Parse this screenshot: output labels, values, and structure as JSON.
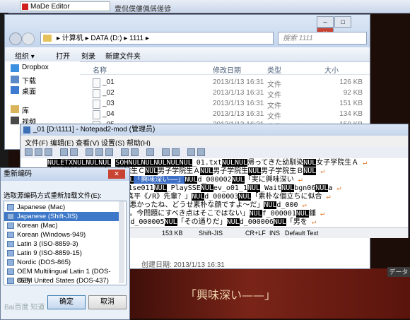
{
  "background": {
    "madeditor_tab": "MaDe Editor",
    "doc_tab": "壹侃僕僂偑偁傞偐",
    "game_text": "「興味深い——」",
    "game_badge": "データ"
  },
  "explorer": {
    "address_parts": [
      "计算机",
      "DATA (D:)",
      "1111"
    ],
    "address_text": "▸ 计算机 ▸ DATA (D:) ▸ 1111 ▸",
    "search_placeholder": "搜索 1111",
    "toolbar": [
      "组织 ▾",
      "打开",
      "刻录",
      "新建文件夹"
    ],
    "sidebar": [
      "Dropbox",
      "下载",
      "桌面",
      "库",
      "视频"
    ],
    "headers": [
      "名称",
      "修改日期",
      "类型",
      "大小"
    ],
    "files": [
      {
        "name": "_01",
        "date": "2013/1/13 16:31",
        "type": "文件",
        "size": "126 KB"
      },
      {
        "name": "_02",
        "date": "2013/1/13 16:31",
        "type": "文件",
        "size": "92 KB"
      },
      {
        "name": "_03",
        "date": "2013/1/13 16:31",
        "type": "文件",
        "size": "151 KB"
      },
      {
        "name": "_04",
        "date": "2013/1/13 16:31",
        "type": "文件",
        "size": "134 KB"
      },
      {
        "name": "_05",
        "date": "2013/1/13 16:31",
        "type": "文件",
        "size": "150 KB"
      }
    ],
    "created": "创建日期: 2013/1/13 16:31"
  },
  "notepad": {
    "title": "_01 [D:\\1111] - Notepad2-mod (管理员)",
    "menu": [
      "文件(F)",
      "编辑(E)",
      "查看(V)",
      "设置(S)",
      "帮助(H)"
    ],
    "status": [
      "153 KB",
      "Shift-JIS",
      "CR+LF",
      "INS",
      "Default Text"
    ]
  },
  "dialog": {
    "title": "重新编码",
    "close": "✕",
    "label": "选取源编码方式重新加载文件(E):",
    "options": [
      "Japanese (Mac)",
      "Japanese (Shift-JIS)",
      "Korean (Mac)",
      "Korean (Windows-949)",
      "Latin 3 (ISO-8859-3)",
      "Latin 9 (ISO-8859-15)",
      "Nordic (DOS-865)",
      "OEM Multilingual Latin 1 (DOS-858)",
      "OEM United States (DOS-437)"
    ],
    "selected": "Japanese (Shift-JIS)",
    "ok": "确定",
    "cancel": "取消"
  },
  "watermark": "Bai百度 知道"
}
